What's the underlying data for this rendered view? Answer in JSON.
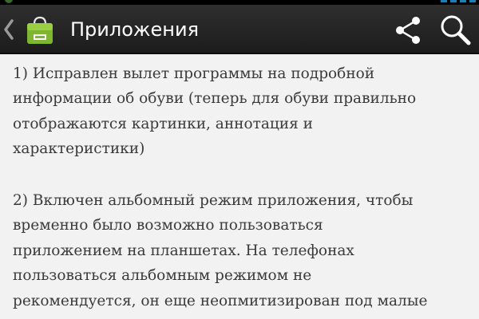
{
  "action_bar": {
    "title": "Приложения",
    "icons": {
      "up": "chevron-left-icon",
      "app": "android-market-bag-icon",
      "share": "share-icon",
      "search": "search-icon"
    }
  },
  "content": {
    "paragraphs": [
      "1) Исправлен вылет программы на подробной\nинформации об обуви (теперь для обуви правильно\nотображаются картинки, аннотация и\nхарактеристики)",
      "2) Включен альбомный режим приложения, чтобы\nвременно было возможно пользоваться\nприложением на планшетах. На телефонах\nпользоваться альбомным режимом не\nрекомендуется, он еще неопмитизирован под малые"
    ]
  },
  "colors": {
    "action_bar_bg": "#232323",
    "content_bg": "#f2f2f2",
    "text": "#3a3a3a",
    "app_icon_green": "#7fb631"
  }
}
